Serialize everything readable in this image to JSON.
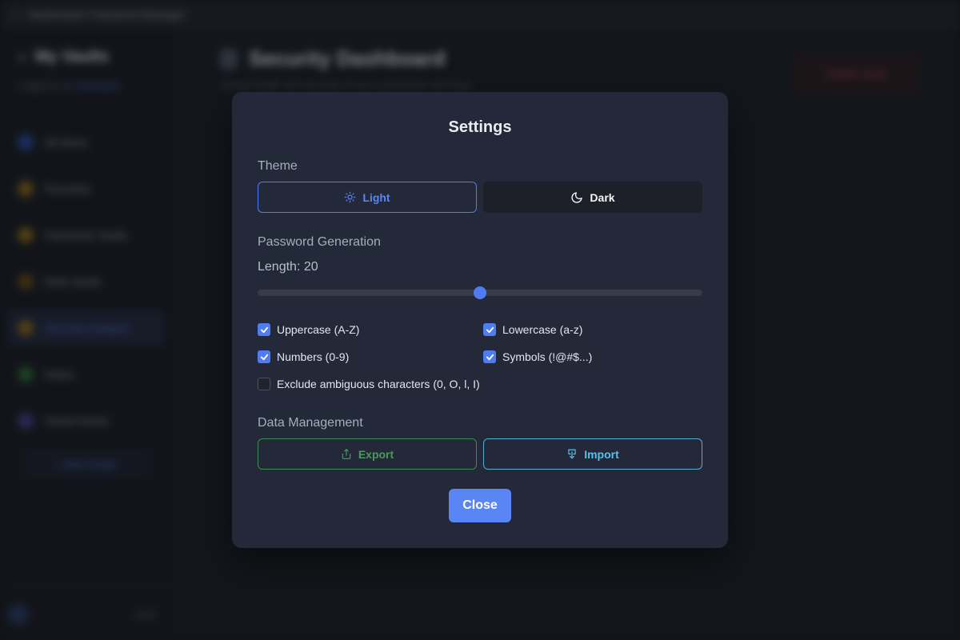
{
  "app": {
    "window_title": "Vaultmaster Password Manager",
    "vault_name": "My Vaults",
    "vault_subtitle": "Logged in as",
    "vault_subtitle_link": "Username",
    "nav": [
      {
        "label": "All Items",
        "color": "#2b4aa0"
      },
      {
        "label": "Favorites",
        "color": "#8a6a1f"
      },
      {
        "label": "Password Vaults",
        "color": "#8a6a1f"
      },
      {
        "label": "Web Vaults",
        "color": "#6b4a1f"
      },
      {
        "label": "Security Analysis",
        "color": "#8a6a1f"
      },
      {
        "label": "Notes",
        "color": "#2f6a3a"
      },
      {
        "label": "Saved Notes",
        "color": "#4a3f8a"
      }
    ],
    "new_folder": "+ New Folder",
    "lock": "Lock",
    "page_title": "Security Dashboard",
    "page_subtitle": "Check health and security of your passwords and keys",
    "danger_button": "Delete Vault"
  },
  "settings": {
    "title": "Settings",
    "theme_label": "Theme",
    "theme_light": "Light",
    "theme_dark": "Dark",
    "password_generation_label": "Password Generation",
    "length_label": "Length: 20",
    "length_slider_level": 0.5,
    "options": {
      "uppercase": {
        "label": "Uppercase (A-Z)",
        "checked": true
      },
      "lowercase": {
        "label": "Lowercase (a-z)",
        "checked": true
      },
      "numbers": {
        "label": "Numbers (0-9)",
        "checked": true
      },
      "symbols": {
        "label": "Symbols (!@#$...)",
        "checked": true
      },
      "exclude_ambiguous": {
        "label": "Exclude ambiguous characters (0, O, l, I)",
        "checked": false
      }
    },
    "data_management_label": "Data Management",
    "export_label": "Export",
    "import_label": "Import",
    "close_label": "Close"
  },
  "colors": {
    "accent": "#5a86f5",
    "export": "#4a9a5e",
    "import": "#5fc0e6"
  }
}
